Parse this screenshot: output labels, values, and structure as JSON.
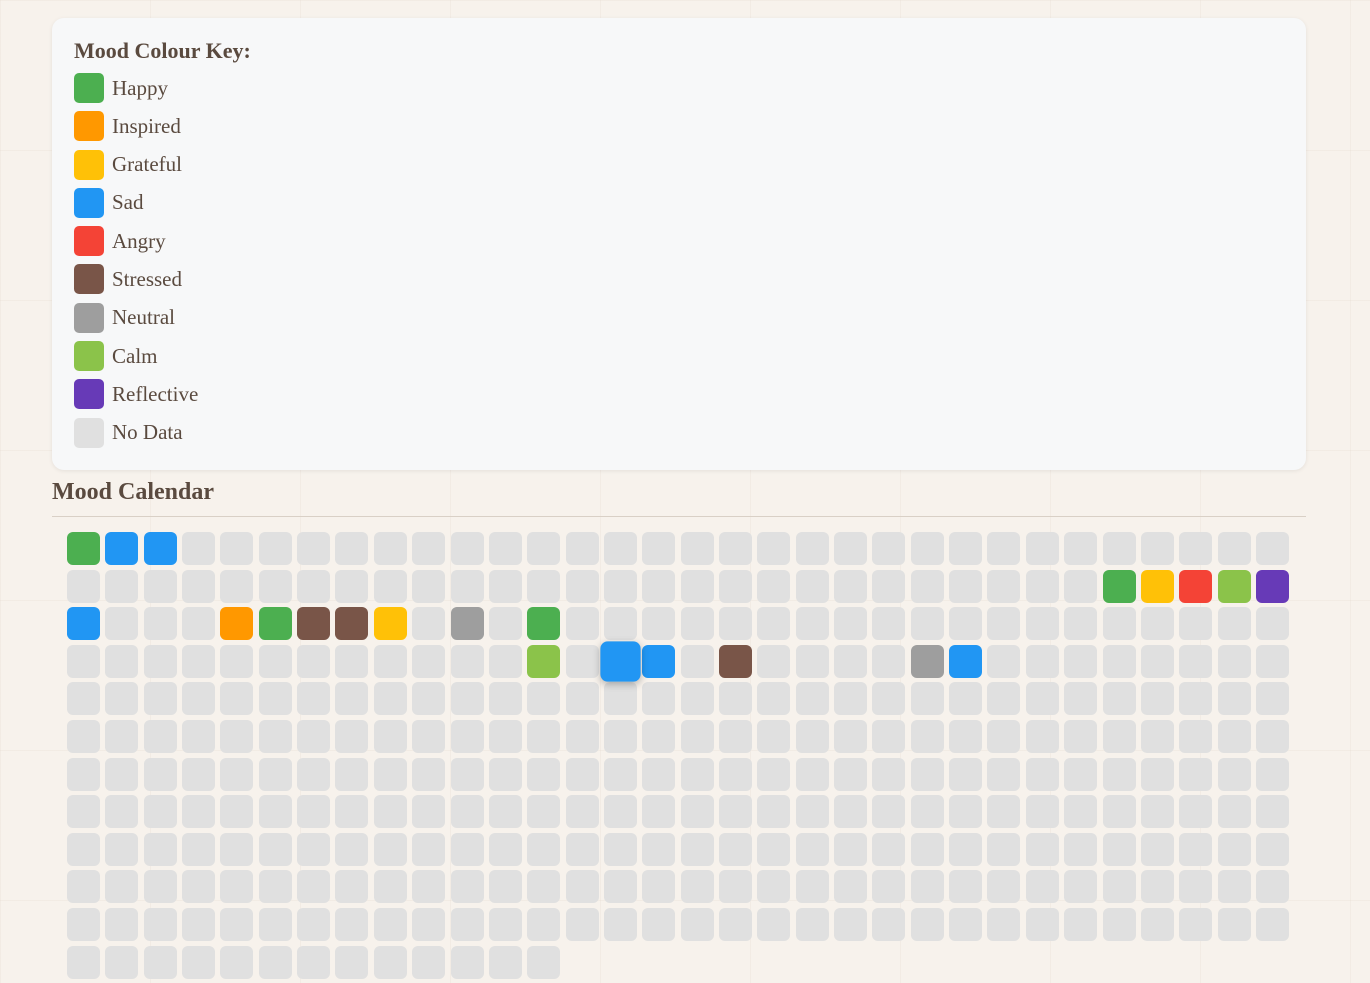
{
  "legend": {
    "title": "Mood Colour Key:",
    "items": [
      {
        "label": "Happy",
        "color": "#4caf50"
      },
      {
        "label": "Inspired",
        "color": "#ff9800"
      },
      {
        "label": "Grateful",
        "color": "#ffc107"
      },
      {
        "label": "Sad",
        "color": "#2196f3"
      },
      {
        "label": "Angry",
        "color": "#f44336"
      },
      {
        "label": "Stressed",
        "color": "#795548"
      },
      {
        "label": "Neutral",
        "color": "#9e9e9e"
      },
      {
        "label": "Calm",
        "color": "#8bc34a"
      },
      {
        "label": "Reflective",
        "color": "#673ab7"
      },
      {
        "label": "No Data",
        "color": "#e0e0e0"
      }
    ]
  },
  "calendar": {
    "title": "Mood Calendar",
    "columns": 32,
    "total_days": 365,
    "selected_day": 110,
    "moods": {
      "0": "Happy",
      "1": "Sad",
      "2": "Sad",
      "59": "Happy",
      "60": "Grateful",
      "61": "Angry",
      "62": "Calm",
      "63": "Reflective",
      "64": "Sad",
      "68": "Inspired",
      "69": "Happy",
      "70": "Stressed",
      "71": "Stressed",
      "72": "Grateful",
      "74": "Neutral",
      "76": "Happy",
      "108": "Calm",
      "110": "Sad",
      "111": "Sad",
      "113": "Stressed",
      "118": "Neutral",
      "119": "Sad"
    }
  }
}
